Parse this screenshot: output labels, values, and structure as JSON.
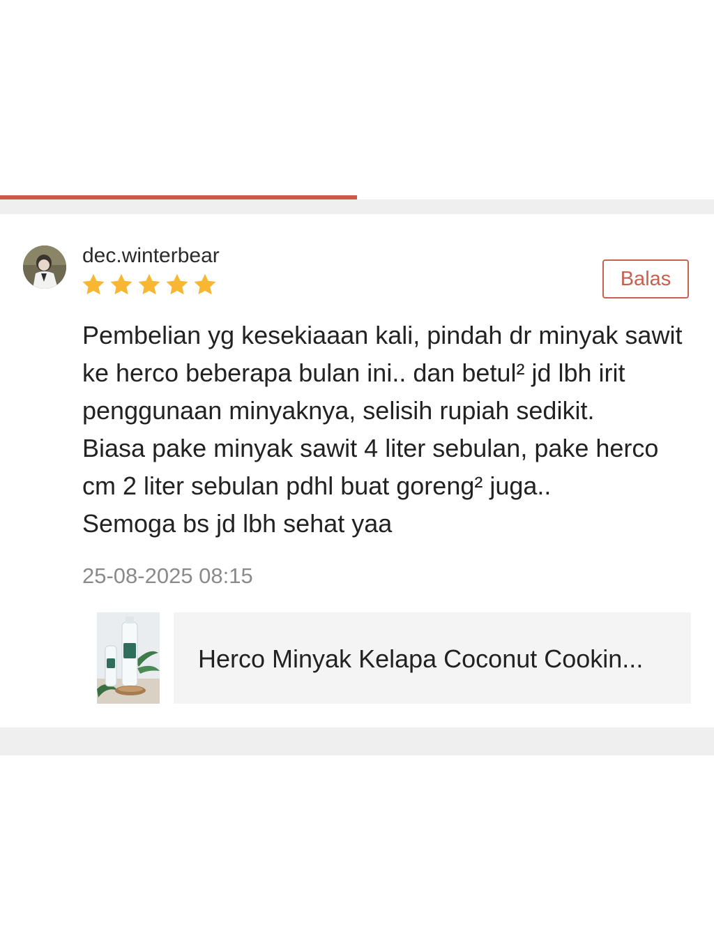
{
  "review": {
    "username": "dec.winterbear",
    "rating": 5,
    "rating_max": 5,
    "reply_label": "Balas",
    "text": "Pembelian yg kesekiaaan kali, pindah dr minyak sawit ke herco beberapa bulan ini.. dan betul² jd lbh irit penggunaan minyaknya, selisih rupiah sedikit.\nBiasa pake minyak sawit 4 liter sebulan, pake herco cm 2 liter sebulan pdhl buat goreng² juga..\nSemoga bs jd lbh sehat yaa",
    "timestamp": "25-08-2025 08:15",
    "product": {
      "title": "Herco Minyak Kelapa Coconut Cookin..."
    }
  },
  "colors": {
    "accent": "#d0584a",
    "reply_border": "#c7614f",
    "star": "#f7b733",
    "timestamp": "#8a8a8a",
    "separator": "#efefef",
    "product_card_bg": "#f4f4f4"
  },
  "icons": {
    "star": "star-icon",
    "avatar": "avatar"
  }
}
